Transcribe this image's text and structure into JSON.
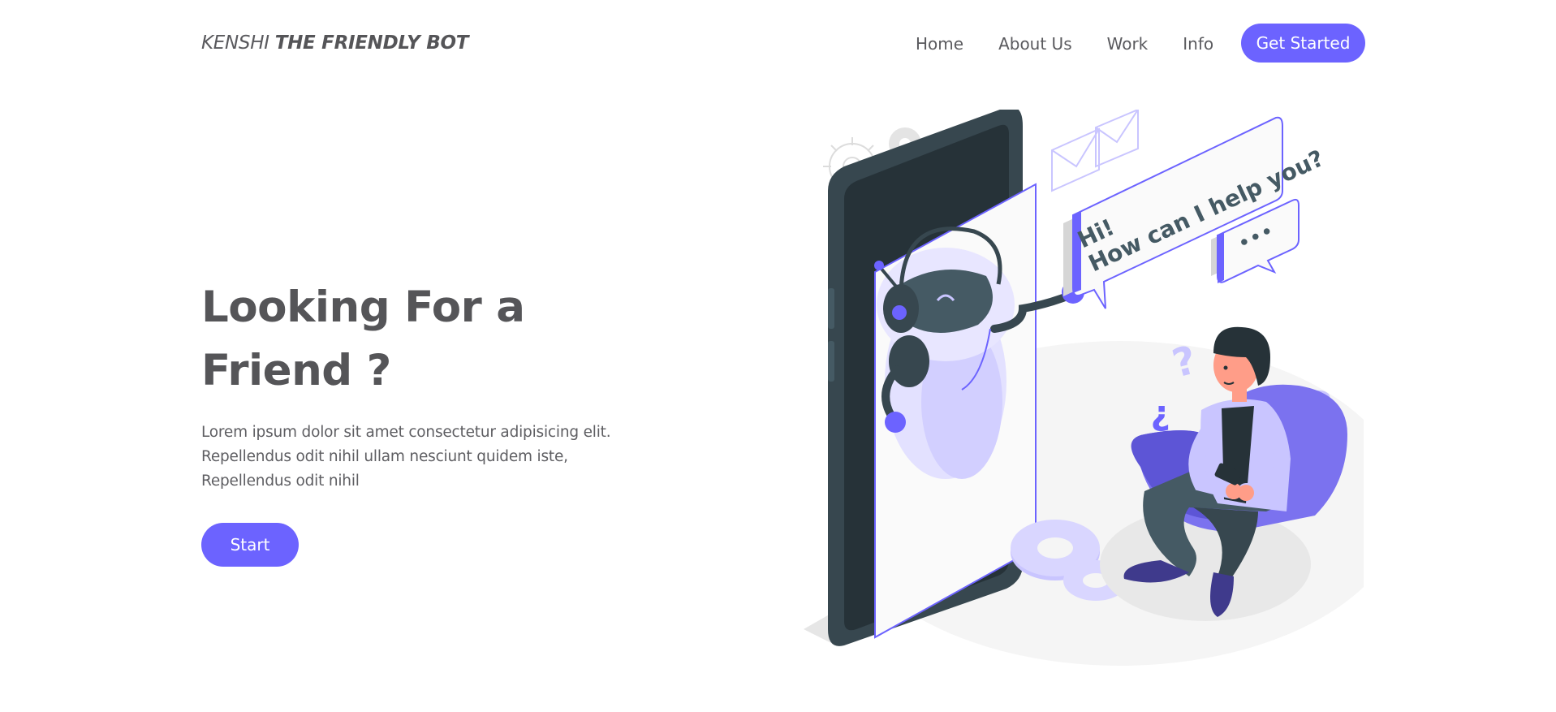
{
  "header": {
    "logo_light": "KENSHI",
    "logo_bold": "THE FRIENDLY BOT",
    "nav": [
      "Home",
      "About Us",
      "Work",
      "Info"
    ],
    "cta_label": "Get Started"
  },
  "hero": {
    "title_line1": "Looking For a",
    "title_line2": "Friend ?",
    "lead_line1": "Lorem ipsum dolor sit amet consectetur adipisicing elit.",
    "lead_line2": "Repellendus odit nihil ullam nesciunt quidem iste,",
    "lead_line3": "Repellendus odit nihil",
    "start_label": "Start"
  },
  "illustration": {
    "bubble_line1": "Hi!",
    "bubble_line2": "How can I help you?",
    "bubble_dots": "•••",
    "accent_color": "#6c63ff",
    "light_accent": "#c9c5ff",
    "phone_color": "#37474f"
  }
}
